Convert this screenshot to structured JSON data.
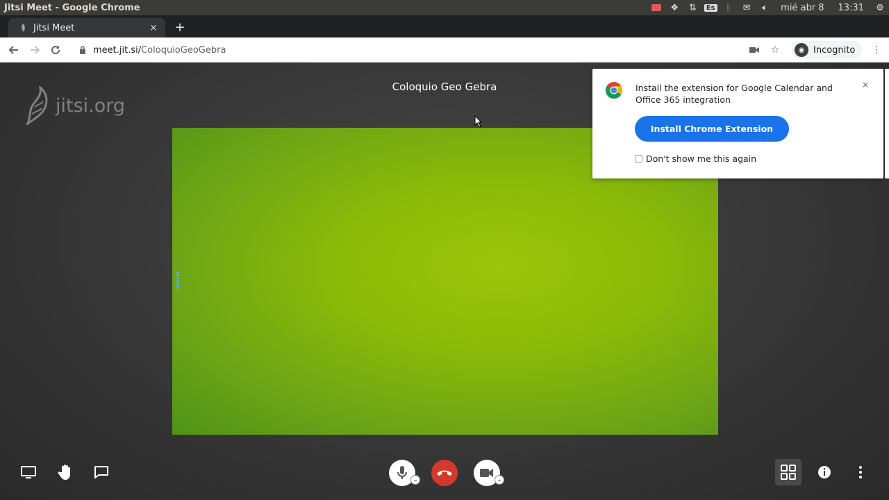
{
  "os": {
    "window_title": "Jitsi Meet - Google Chrome",
    "keyboard_layout": "Es",
    "date": "mié abr 8",
    "time": "13:31"
  },
  "browser": {
    "tab_title": "Jitsi Meet",
    "tab_close": "×",
    "new_tab": "+",
    "url_host": "meet.jit.si/",
    "url_path": "ColoquioGeoGebra",
    "incognito_label": "Incognito"
  },
  "meeting": {
    "watermark": "jitsi.org",
    "subject": "Coloquio Geo Gebra"
  },
  "popup": {
    "message": "Install the extension for Google Calendar and Office 365 integration",
    "close": "×",
    "install_button": "Install Chrome Extension",
    "dont_show": "Don't show me this again"
  },
  "colors": {
    "hangup": "#d33a2c",
    "primary_button": "#1a73e8",
    "video_green": "#8cba08"
  }
}
